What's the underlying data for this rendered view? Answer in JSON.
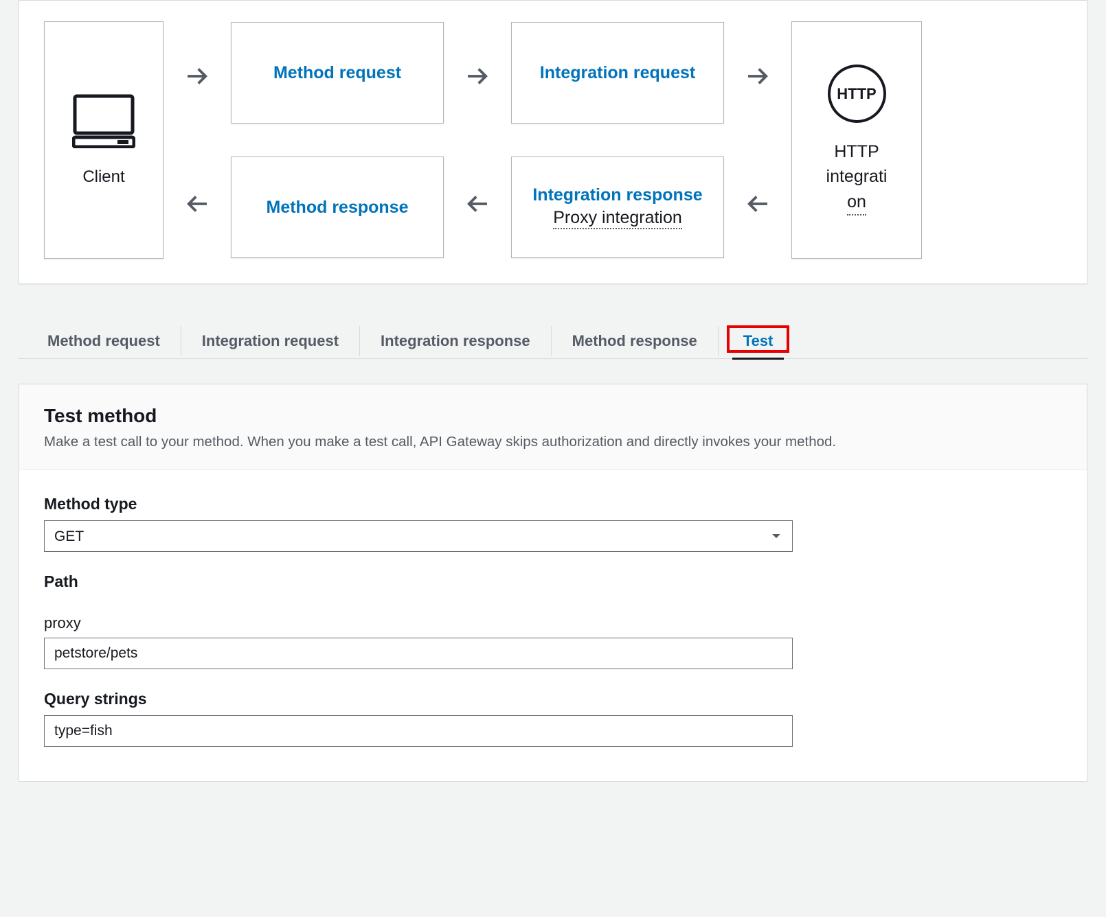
{
  "diagram": {
    "client_label": "Client",
    "method_request": "Method request",
    "integration_request": "Integration request",
    "method_response": "Method response",
    "integration_response": "Integration response",
    "proxy_integration": "Proxy integration",
    "http_badge": "HTTP",
    "http_label_line1": "HTTP",
    "http_label_line2": "integrati",
    "http_label_line3": "on"
  },
  "tabs": {
    "items": [
      "Method request",
      "Integration request",
      "Integration response",
      "Method response",
      "Test"
    ],
    "active_index": 4,
    "highlighted_index": 4
  },
  "test": {
    "title": "Test method",
    "description": "Make a test call to your method. When you make a test call, API Gateway skips authorization and directly invokes your method.",
    "method_type": {
      "label": "Method type",
      "value": "GET"
    },
    "path": {
      "label": "Path",
      "proxy_label": "proxy",
      "proxy_value": "petstore/pets"
    },
    "query_strings": {
      "label": "Query strings",
      "value": "type=fish"
    }
  }
}
